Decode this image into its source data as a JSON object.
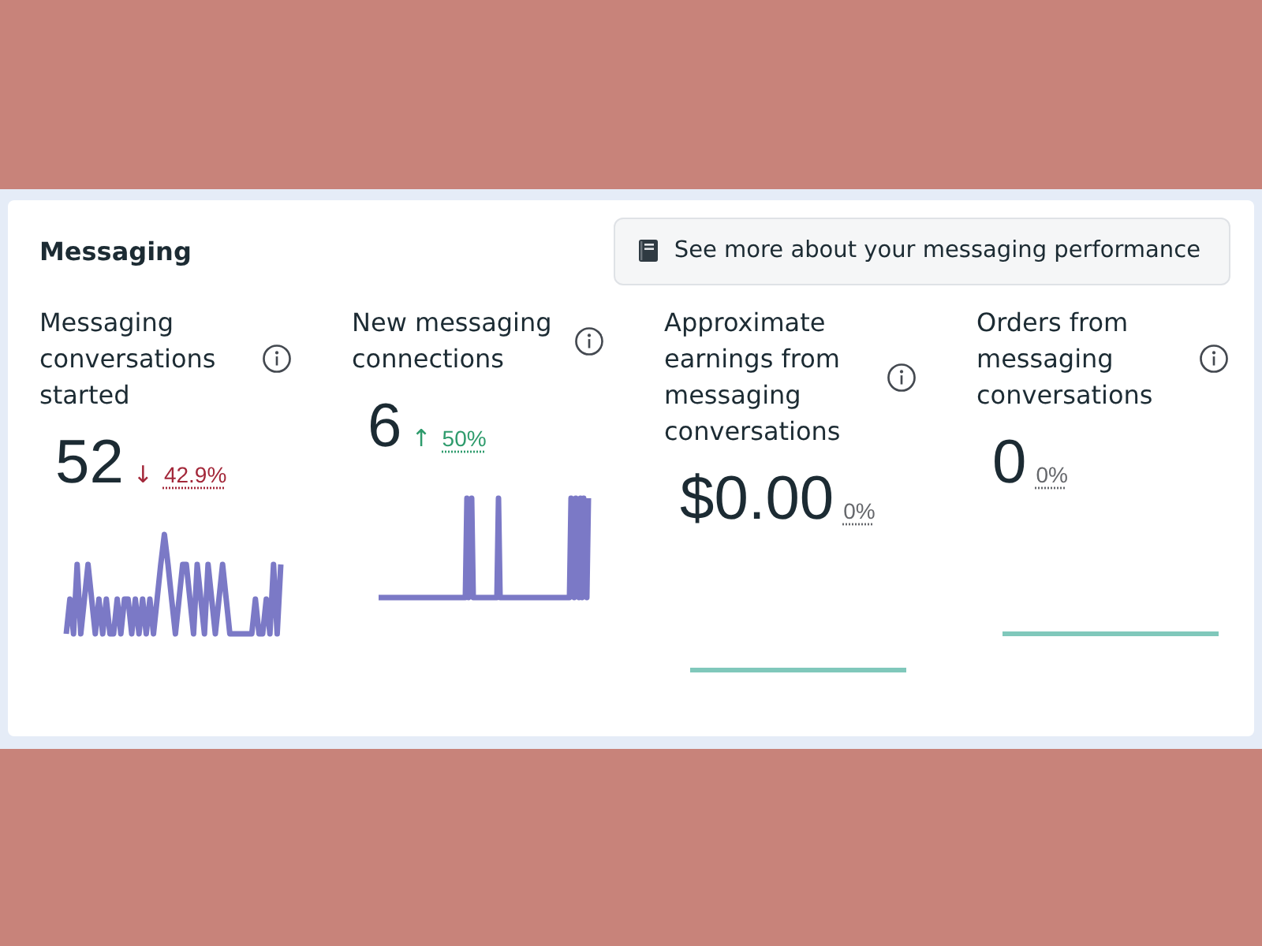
{
  "section": {
    "title": "Messaging",
    "link_button": {
      "label": "See more about your messaging performance"
    }
  },
  "metrics": [
    {
      "title": "Messaging conversations started",
      "value": "52",
      "change": {
        "arrow": "↓",
        "text": "42.9%",
        "color": "#a3283a"
      },
      "kind": "trend"
    },
    {
      "title": "New messaging connections",
      "value": "6",
      "change": {
        "arrow": "↑",
        "text": "50%",
        "color": "#2e9b6c"
      },
      "kind": "trend"
    },
    {
      "title": "Approximate earnings from messaging conversations",
      "value": "$0.00",
      "change": {
        "text": "0%",
        "color": "#65676b"
      },
      "kind": "flat"
    },
    {
      "title": "Orders from messaging conversations",
      "value": "0",
      "change": {
        "text": "0%",
        "color": "#65676b"
      },
      "kind": "flat"
    }
  ]
}
